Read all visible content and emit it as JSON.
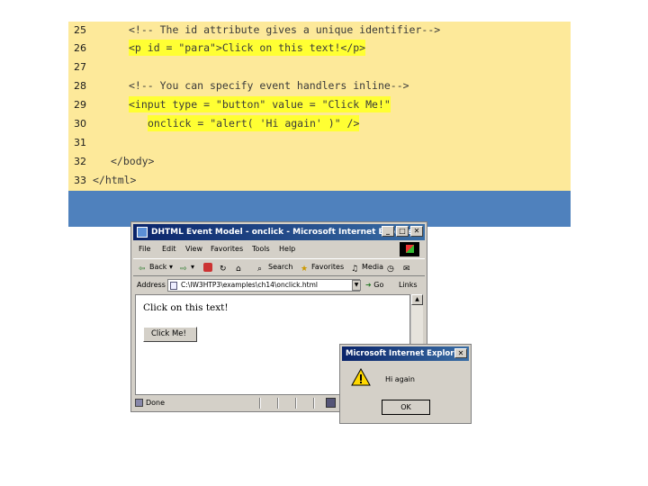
{
  "code": {
    "lines": [
      {
        "num": "25",
        "text": "<!-- The id attribute gives a unique identifier-->",
        "highlight": false
      },
      {
        "num": "26",
        "text": "<p id = \"para\">Click on this text!</p>",
        "highlight": true
      },
      {
        "num": "27",
        "text": "",
        "highlight": false
      },
      {
        "num": "28",
        "text": "<!-- You can specify event handlers inline-->",
        "highlight": false
      },
      {
        "num": "29",
        "text": "<input type = \"button\" value = \"Click Me!\"",
        "highlight": true
      },
      {
        "num": "30",
        "text": "onclick = \"alert( 'Hi again' )\" />",
        "highlight": true
      },
      {
        "num": "31",
        "text": "",
        "highlight": false
      },
      {
        "num": "32",
        "text": "</body>",
        "highlight": false
      },
      {
        "num": "33",
        "text": "</html>",
        "highlight": false
      }
    ]
  },
  "ie_window": {
    "title": "DHTML Event Model - onclick - Microsoft Internet Explorer",
    "menu": [
      "File",
      "Edit",
      "View",
      "Favorites",
      "Tools",
      "Help"
    ],
    "toolbar": {
      "back": "Back",
      "search": "Search",
      "favorites": "Favorites",
      "media": "Media"
    },
    "address": {
      "label": "Address",
      "value": "C:\\IW3HTP3\\examples\\ch14\\onclick.html",
      "go": "Go",
      "links": "Links"
    },
    "content": {
      "paragraph": "Click on this text!",
      "button": "Click Me!"
    },
    "status": "Done"
  },
  "alert": {
    "title": "Microsoft Internet Explorer",
    "message": "Hi again",
    "ok": "OK"
  },
  "colors": {
    "code_background": "#fde99a",
    "code_highlight": "#ffff33",
    "footer_band": "#4f81bd",
    "titlebar": "#0a246a"
  }
}
